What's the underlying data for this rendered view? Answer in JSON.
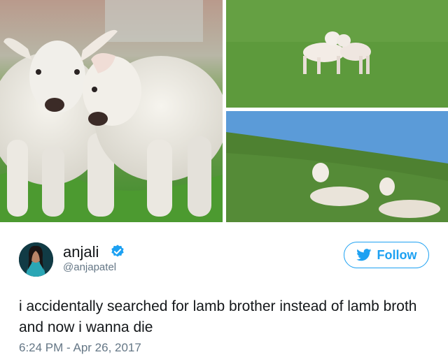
{
  "media": {
    "photos": [
      {
        "name": "two lambs nuzzling close-up"
      },
      {
        "name": "two lambs embracing in field"
      },
      {
        "name": "two lambs lying on hillside"
      }
    ]
  },
  "tweet": {
    "display_name": "anjali",
    "handle": "@anjapatel",
    "verified": true,
    "follow_label": "Follow",
    "text": "i accidentally searched for lamb brother instead of lamb broth and now i wanna die",
    "timestamp": "6:24 PM - Apr 26, 2017"
  },
  "colors": {
    "twitter_blue": "#1da1f2",
    "text_primary": "#14171a",
    "text_secondary": "#657786"
  },
  "icons": [
    "verified-badge-icon",
    "twitter-bird-icon"
  ]
}
